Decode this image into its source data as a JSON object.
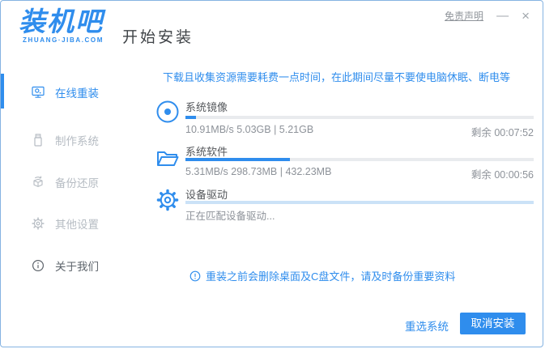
{
  "window": {
    "disclaimer": "免责声明",
    "minimize_icon": "—",
    "close_icon": "×"
  },
  "logo": {
    "title": "装机吧",
    "subtitle": "ZHUANG·JIBA.COM"
  },
  "header": {
    "title": "开始安装"
  },
  "sidebar": {
    "items": [
      {
        "label": "在线重装",
        "icon": "monitor-icon",
        "state": "active"
      },
      {
        "label": "制作系统",
        "icon": "usb-icon",
        "state": "disabled"
      },
      {
        "label": "备份还原",
        "icon": "backup-icon",
        "state": "disabled"
      },
      {
        "label": "其他设置",
        "icon": "settings-icon",
        "state": "disabled"
      },
      {
        "label": "关于我们",
        "icon": "info-icon",
        "state": "normal"
      }
    ]
  },
  "main": {
    "notice": "下载且收集资源需要耗费一点时间，在此期间尽量不要使电脑休眠、断电等",
    "tasks": [
      {
        "name": "系统镜像",
        "icon": "disc-icon",
        "progress_percent": 3,
        "stats": "10.91MB/s 5.03GB | 5.21GB",
        "remaining": "剩余 00:07:52"
      },
      {
        "name": "系统软件",
        "icon": "folder-icon",
        "progress_percent": 30,
        "stats": "5.31MB/s 298.73MB | 432.23MB",
        "remaining": "剩余 00:00:56"
      },
      {
        "name": "设备驱动",
        "icon": "gear-icon",
        "progress_percent": 0,
        "indeterminate": true,
        "status": "正在匹配设备驱动..."
      }
    ],
    "warning": "重装之前会删除桌面及C盘文件，请及时备份重要资料"
  },
  "footer": {
    "reselect_label": "重选系统",
    "cancel_label": "取消安装"
  },
  "colors": {
    "accent": "#2f8ded",
    "border": "#85b3e2",
    "track": "#e9ebee",
    "indeterminate_track": "#cbe2f7"
  }
}
